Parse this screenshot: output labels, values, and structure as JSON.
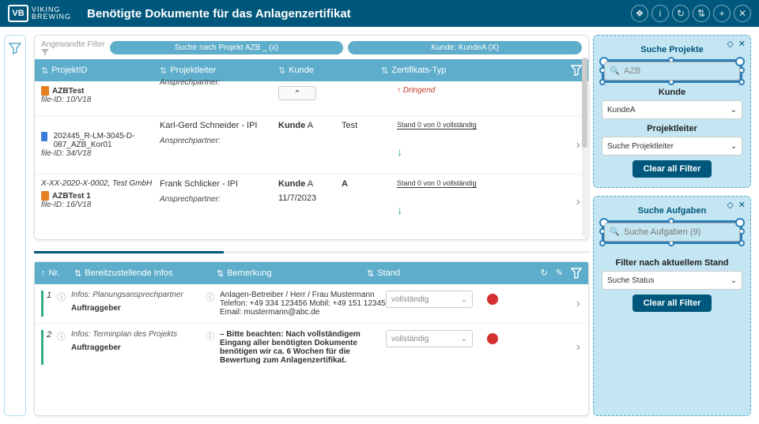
{
  "brand": {
    "code": "VB",
    "name1": "VIKING",
    "name2": "BREWING"
  },
  "title": "Benötigte Dokumente für das Anlagenzertifikat",
  "filters": {
    "label": "Angewandte Filter",
    "chip1": "Suche nach Projekt AZB _ (x)",
    "chip2": "Kunde: KundeA (X)"
  },
  "cols": {
    "c1": "ProjektID",
    "c2": "Projektleiter",
    "c3": "Kunde",
    "c4": "Zertifikats-Typ"
  },
  "rows": [
    {
      "file": "AZBTest",
      "id": "file-ID: 10/V18",
      "ansp": "Ansprechpartner:",
      "dringend": "Dringend"
    },
    {
      "file": "202445_R-LM-3045-D-087_AZB_Kor01",
      "id": "file-ID: 34/V18",
      "pl": "Karl-Gerd Schneider - IPI",
      "ansp": "Ansprechpartner:",
      "kunde": "Kunde",
      "ka": "A",
      "typ": "Test",
      "stand": "Stand 0 von 0 vollständig"
    },
    {
      "file": "AZBTest 1",
      "sub": "X-XX-2020-X-0002, Test GmbH",
      "id": "file-ID: 16/V18",
      "pl": "Frank Schlicker - IPI",
      "ansp": "Ansprechpartner:",
      "date": "11/7/2023",
      "kunde": "Kunde",
      "ka": "A",
      "typ": "A",
      "stand": "Stand 0 von 0 vollständig"
    }
  ],
  "bot": {
    "cols": {
      "c1": "Nr.",
      "c2": "Bereitzustellende Infos",
      "c3": "Bemerkung",
      "c4": "Stand"
    },
    "rows": [
      {
        "n": "1",
        "info": "Infos: Planungsansprechpartner",
        "auft": "Auftraggeber",
        "bem": "Anlagen-Betreiber  / Herr / Frau Mustermann Telefon: +49 334 123456 Mobil: +49 151 12345\nEmail: mustermann@abc.de",
        "stand": "vollständig"
      },
      {
        "n": "2",
        "info": "Infos: Terminplan des Projekts",
        "auft": "Auftraggeber",
        "bem": "– Bitte beachten: Nach vollständigem Eingang aller benötigten Dokumente benötigen wir ca. 6 Wochen für die Bewertung zum Anlagenzertifikat.",
        "stand": "vollständig"
      }
    ]
  },
  "fp1": {
    "h": "Suche Projekte",
    "val": "AZB",
    "l1": "Kunde",
    "v1": "KundeA",
    "l2": "Projektleiter",
    "v2": "Suche Projektleiter",
    "btn": "Clear all Filter"
  },
  "fp2": {
    "h": "Suche Aufgaben",
    "ph": "Suche Aufgaben (9)",
    "l1": "Filter nach aktuellem Stand",
    "v1": "Suche Status",
    "btn": "Clear all Filter"
  }
}
